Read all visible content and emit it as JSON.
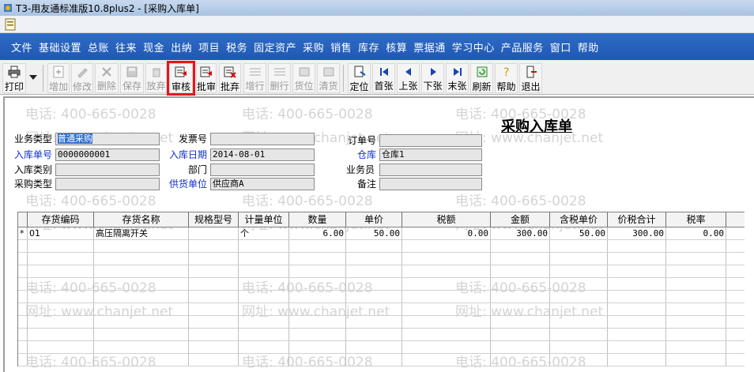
{
  "window": {
    "title": "T3-用友通标准版10.8plus2 - [采购入库单]"
  },
  "menu": [
    "文件",
    "基础设置",
    "总账",
    "往来",
    "现金",
    "出纳",
    "项目",
    "税务",
    "固定资产",
    "采购",
    "销售",
    "库存",
    "核算",
    "票据通",
    "学习中心",
    "产品服务",
    "窗口",
    "帮助"
  ],
  "toolbar": {
    "print": "打印",
    "add": "增加",
    "edit": "修改",
    "delete": "删除",
    "save": "保存",
    "discard": "放弃",
    "audit": "审核",
    "batch_audit": "批审",
    "batch_discard": "批弃",
    "add_row": "增行",
    "delete_row": "删行",
    "goods": "货位",
    "clear": "清货",
    "locate": "定位",
    "first": "首张",
    "prev": "上张",
    "next": "下张",
    "last": "末张",
    "refresh": "刷新",
    "help": "帮助",
    "exit": "退出"
  },
  "watermark": {
    "phone": "电话: 400-665-0028",
    "site": "网址: www.chanjet.net"
  },
  "form": {
    "title": "采购入库单",
    "biz_type_label": "业务类型",
    "biz_type_value": "普通采购",
    "invoice_no_label": "发票号",
    "invoice_no_value": "",
    "order_no_label": "订单号",
    "order_no_value": "",
    "entry_no_label": "入库单号",
    "entry_no_value": "0000000001",
    "entry_date_label": "入库日期",
    "entry_date_value": "2014-08-01",
    "warehouse_label": "仓库",
    "warehouse_value": "仓库1",
    "entry_cat_label": "入库类别",
    "entry_cat_value": "",
    "dept_label": "部门",
    "dept_value": "",
    "staff_label": "业务员",
    "staff_value": "",
    "purchase_type_label": "采购类型",
    "purchase_type_value": "",
    "supplier_label": "供货单位",
    "supplier_value": "供应商A",
    "remark_label": "备注",
    "remark_value": ""
  },
  "grid": {
    "headers": [
      "存货编码",
      "存货名称",
      "规格型号",
      "计量单位",
      "数量",
      "单价",
      "税额",
      "金额",
      "含税单价",
      "价税合计",
      "税率"
    ],
    "rows": [
      {
        "marker": "*",
        "code": "01",
        "name": "高压隔离开关",
        "spec": "",
        "unit": "个",
        "qty": "6.00",
        "price": "50.00",
        "tax": "0.00",
        "amount": "300.00",
        "tax_price": "50.00",
        "total": "300.00",
        "rate": "0.00"
      }
    ]
  }
}
